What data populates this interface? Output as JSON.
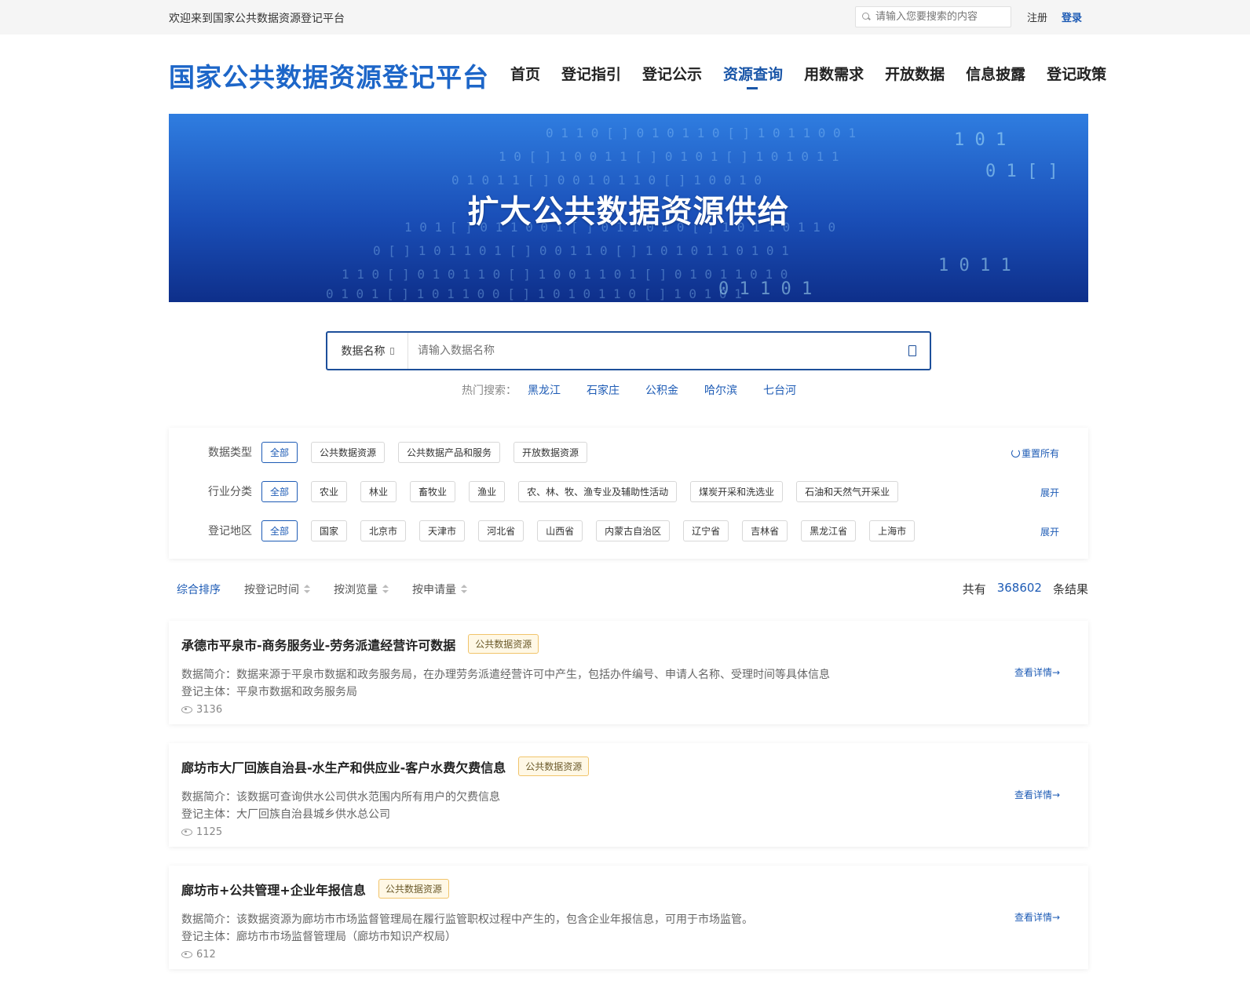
{
  "topbar": {
    "welcome": "欢迎来到国家公共数据资源登记平台",
    "search_placeholder": "请输入您要搜索的内容",
    "register": "注册",
    "login": "登录"
  },
  "header": {
    "logo": "国家公共数据资源登记平台",
    "nav": [
      "首页",
      "登记指引",
      "登记公示",
      "资源查询",
      "用数需求",
      "开放数据",
      "信息披露",
      "登记政策"
    ],
    "active_nav": "资源查询"
  },
  "banner": {
    "title": "扩大公共数据资源供给"
  },
  "search": {
    "field": "数据名称",
    "placeholder": "请输入数据名称",
    "hot_label": "热门搜索：",
    "hot_keywords": [
      "黑龙江",
      "石家庄",
      "公积金",
      "哈尔滨",
      "七台河"
    ]
  },
  "filters": {
    "type_label": "数据类型",
    "types": [
      "全部",
      "公共数据资源",
      "公共数据产品和服务",
      "开放数据资源"
    ],
    "reset": "重置所有",
    "industry_label": "行业分类",
    "industries": [
      "全部",
      "农业",
      "林业",
      "畜牧业",
      "渔业",
      "农、林、牧、渔专业及辅助性活动",
      "煤炭开采和洗选业",
      "石油和天然气开采业"
    ],
    "industry_expand": "展开",
    "region_label": "登记地区",
    "regions": [
      "全部",
      "国家",
      "北京市",
      "天津市",
      "河北省",
      "山西省",
      "内蒙古自治区",
      "辽宁省",
      "吉林省",
      "黑龙江省",
      "上海市"
    ],
    "region_expand": "展开"
  },
  "sort": {
    "options": [
      "综合排序",
      "按登记时间",
      "按浏览量",
      "按申请量"
    ],
    "total_prefix": "共有",
    "total": "368602",
    "total_suffix": "条结果"
  },
  "results": [
    {
      "title": "承德市平泉市-商务服务业-劳务派遣经营许可数据",
      "badge": "公共数据资源",
      "desc": "数据简介：数据来源于平泉市数据和政务服务局，在办理劳务派遣经营许可中产生，包括办件编号、申请人名称、受理时间等具体信息",
      "subject": "登记主体：平泉市数据和政务服务局",
      "views": "3136",
      "detail": "查看详情→"
    },
    {
      "title": "廊坊市大厂回族自治县-水生产和供应业-客户水费欠费信息",
      "badge": "公共数据资源",
      "desc": "数据简介：该数据可查询供水公司供水范围内所有用户的欠费信息",
      "subject": "登记主体：大厂回族自治县城乡供水总公司",
      "views": "1125",
      "detail": "查看详情→"
    },
    {
      "title": "廊坊市+公共管理+企业年报信息",
      "badge": "公共数据资源",
      "desc": "数据简介：该数据资源为廊坊市市场监督管理局在履行监管职权过程中产生的，包含企业年报信息，可用于市场监管。",
      "subject": "登记主体：廊坊市市场监督管理局（廊坊市知识产权局）",
      "views": "612",
      "detail": "查看详情→"
    }
  ]
}
